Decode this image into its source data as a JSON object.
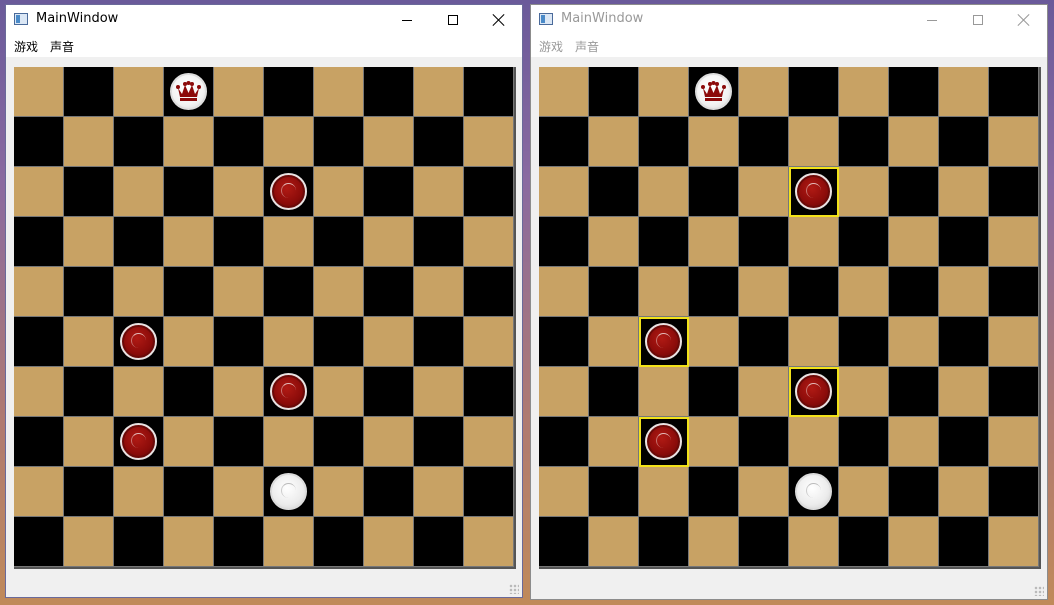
{
  "windows": [
    {
      "title": "MainWindow",
      "active": true,
      "menu": [
        "游戏",
        "声音"
      ],
      "pieces": [
        {
          "row": 0,
          "col": 3,
          "kind": "king-white"
        },
        {
          "row": 2,
          "col": 5,
          "kind": "red"
        },
        {
          "row": 5,
          "col": 2,
          "kind": "red"
        },
        {
          "row": 6,
          "col": 5,
          "kind": "red"
        },
        {
          "row": 7,
          "col": 2,
          "kind": "red"
        },
        {
          "row": 8,
          "col": 5,
          "kind": "white"
        }
      ],
      "highlighted": []
    },
    {
      "title": "MainWindow",
      "active": false,
      "menu": [
        "游戏",
        "声音"
      ],
      "pieces": [
        {
          "row": 0,
          "col": 3,
          "kind": "king-white"
        },
        {
          "row": 2,
          "col": 5,
          "kind": "red"
        },
        {
          "row": 5,
          "col": 2,
          "kind": "red"
        },
        {
          "row": 6,
          "col": 5,
          "kind": "red"
        },
        {
          "row": 7,
          "col": 2,
          "kind": "red"
        },
        {
          "row": 8,
          "col": 5,
          "kind": "white"
        }
      ],
      "highlighted": [
        [
          2,
          5
        ],
        [
          5,
          2
        ],
        [
          6,
          5
        ],
        [
          7,
          2
        ]
      ]
    }
  ],
  "board": {
    "size": 10,
    "light_color": "#c8a264",
    "dark_color": "#000000",
    "highlight_color": "#f2e21a"
  },
  "icons": {
    "minimize": "minimize-icon",
    "maximize": "maximize-icon",
    "close": "close-icon",
    "app": "app-icon"
  }
}
